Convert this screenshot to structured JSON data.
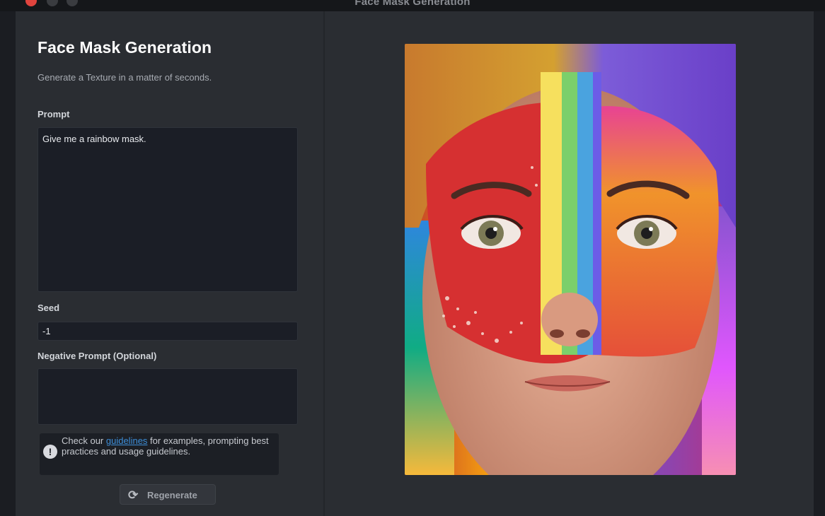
{
  "window": {
    "title": "Face Mask Generation"
  },
  "header": {
    "title": "Face Mask Generation",
    "subtitle": "Generate a Texture in a matter of seconds."
  },
  "form": {
    "prompt": {
      "label": "Prompt",
      "value": "Give me a rainbow mask."
    },
    "seed": {
      "label": "Seed",
      "value": "-1"
    },
    "negative_prompt": {
      "label": "Negative Prompt (Optional)",
      "value": ""
    }
  },
  "info": {
    "text_before": "Check our ",
    "link": "guidelines",
    "text_after": " for examples, prompting best practices and usage guidelines.",
    "icon": "info-icon"
  },
  "actions": {
    "regenerate_label": "Regenerate",
    "regenerate_icon": "refresh-icon"
  },
  "preview": {
    "image": "generated-face-mask"
  },
  "colors": {
    "accent_link": "#3d8ed8",
    "close_button": "#e0443e"
  }
}
